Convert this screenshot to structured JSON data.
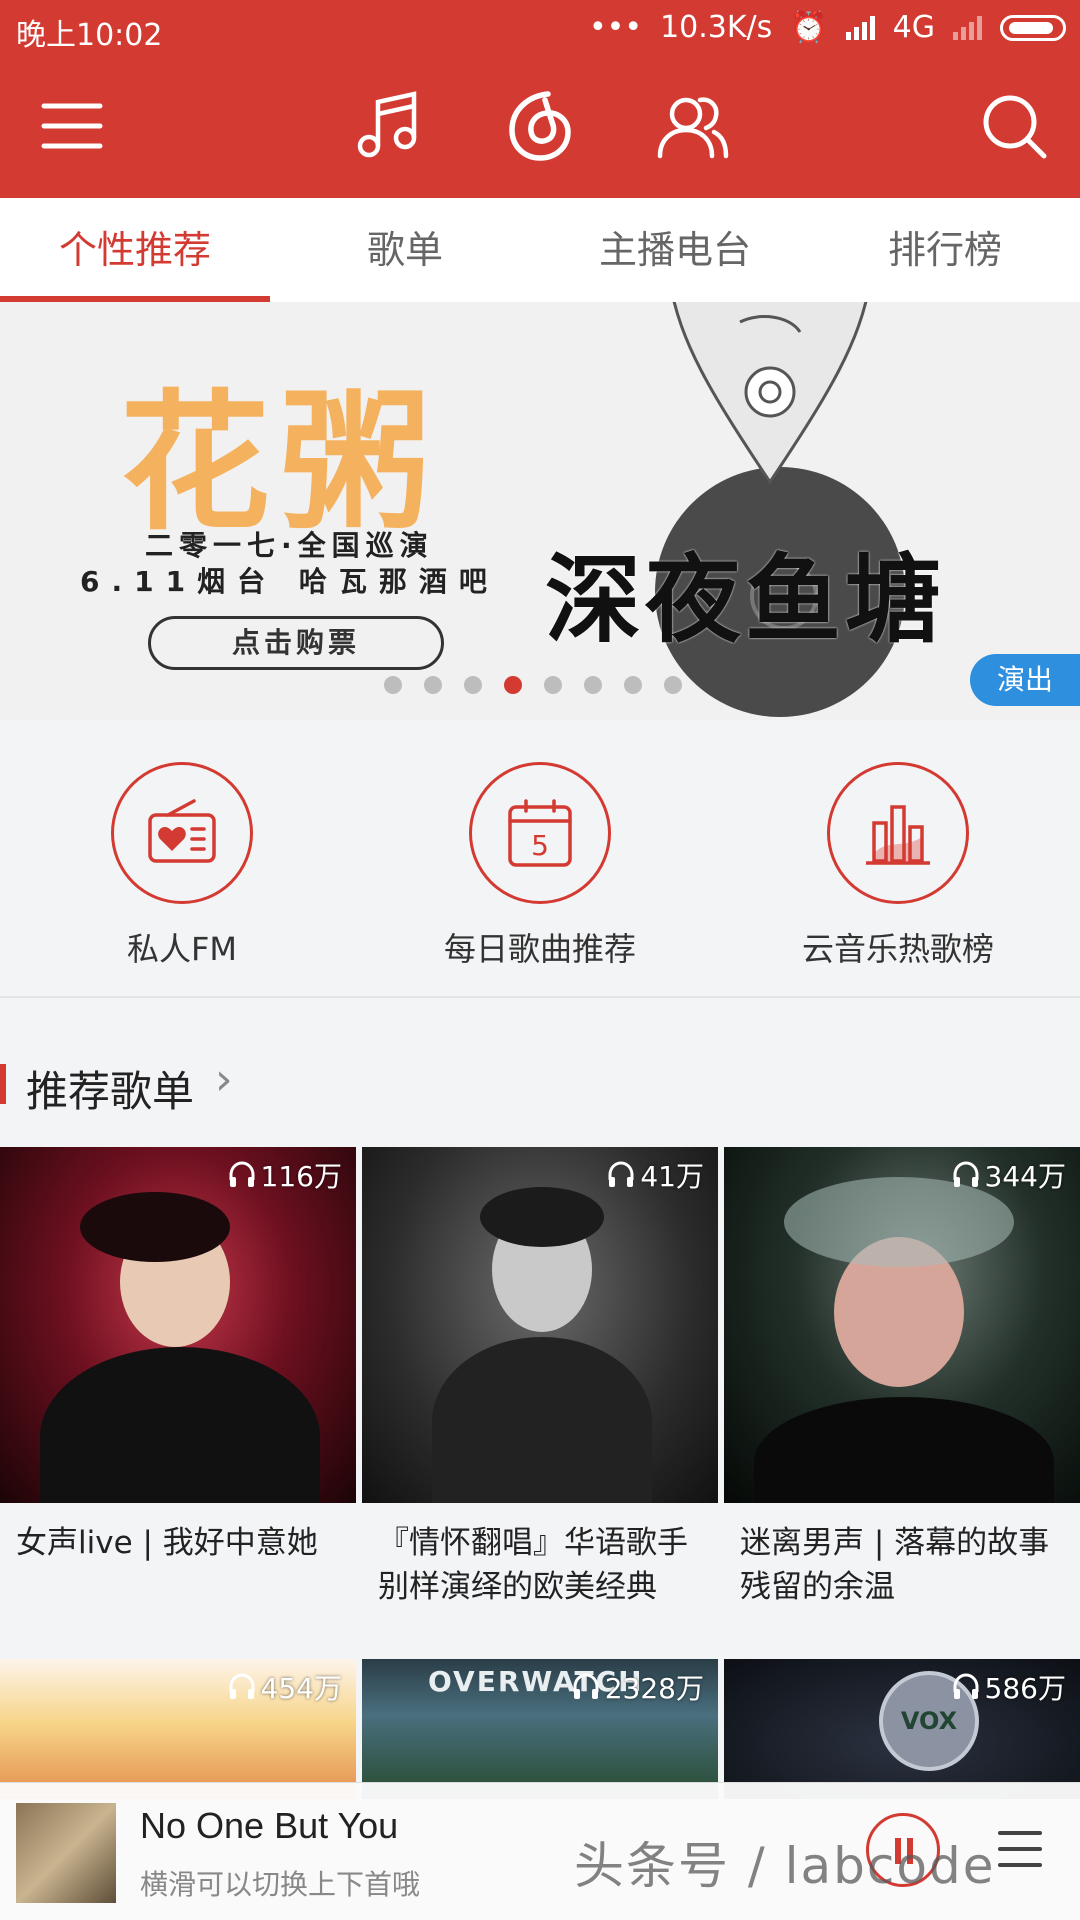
{
  "status_bar": {
    "time": "晚上10:02",
    "dots": "•••",
    "speed": "10.3K/s",
    "network": "4G"
  },
  "top_bar": {
    "icons": [
      "menu-icon",
      "music-icon",
      "netease-logo-icon",
      "friends-icon",
      "search-icon"
    ]
  },
  "tabs": [
    "个性推荐",
    "歌单",
    "主播电台",
    "排行榜"
  ],
  "banner": {
    "title": "花粥",
    "line1": "二零一七·全国巡演",
    "line2": "6.11烟台 哈瓦那酒吧",
    "button": "点击购票",
    "calligraphy": "深夜鱼塘",
    "badge": "演出",
    "page_count": 8,
    "active_page": 4
  },
  "quick_entries": [
    {
      "label": "私人FM",
      "icon": "radio-icon"
    },
    {
      "label": "每日歌曲推荐",
      "icon": "calendar-icon",
      "calendar_day": "5"
    },
    {
      "label": "云音乐热歌榜",
      "icon": "chart-icon"
    }
  ],
  "section": {
    "title": "推荐歌单",
    "arrow": "›"
  },
  "playlists": [
    {
      "count": "116万",
      "name": "女声live | 我好中意她"
    },
    {
      "count": "41万",
      "name": "『情怀翻唱』华语歌手别样演绎的欧美经典"
    },
    {
      "count": "344万",
      "name": "迷离男声 | 落幕的故事残留的余温"
    },
    {
      "count": "454万",
      "name": ""
    },
    {
      "count": "2328万",
      "name": "",
      "cover_text": "OVERWATCH"
    },
    {
      "count": "586万",
      "name": "",
      "cover_text": "VOX"
    }
  ],
  "player": {
    "song": "No One But You",
    "hint": "横滑可以切换上下首哦"
  },
  "watermark": "头条号 / labcode",
  "colors": {
    "brand": "#d33a31",
    "badge": "#2d8fde"
  }
}
